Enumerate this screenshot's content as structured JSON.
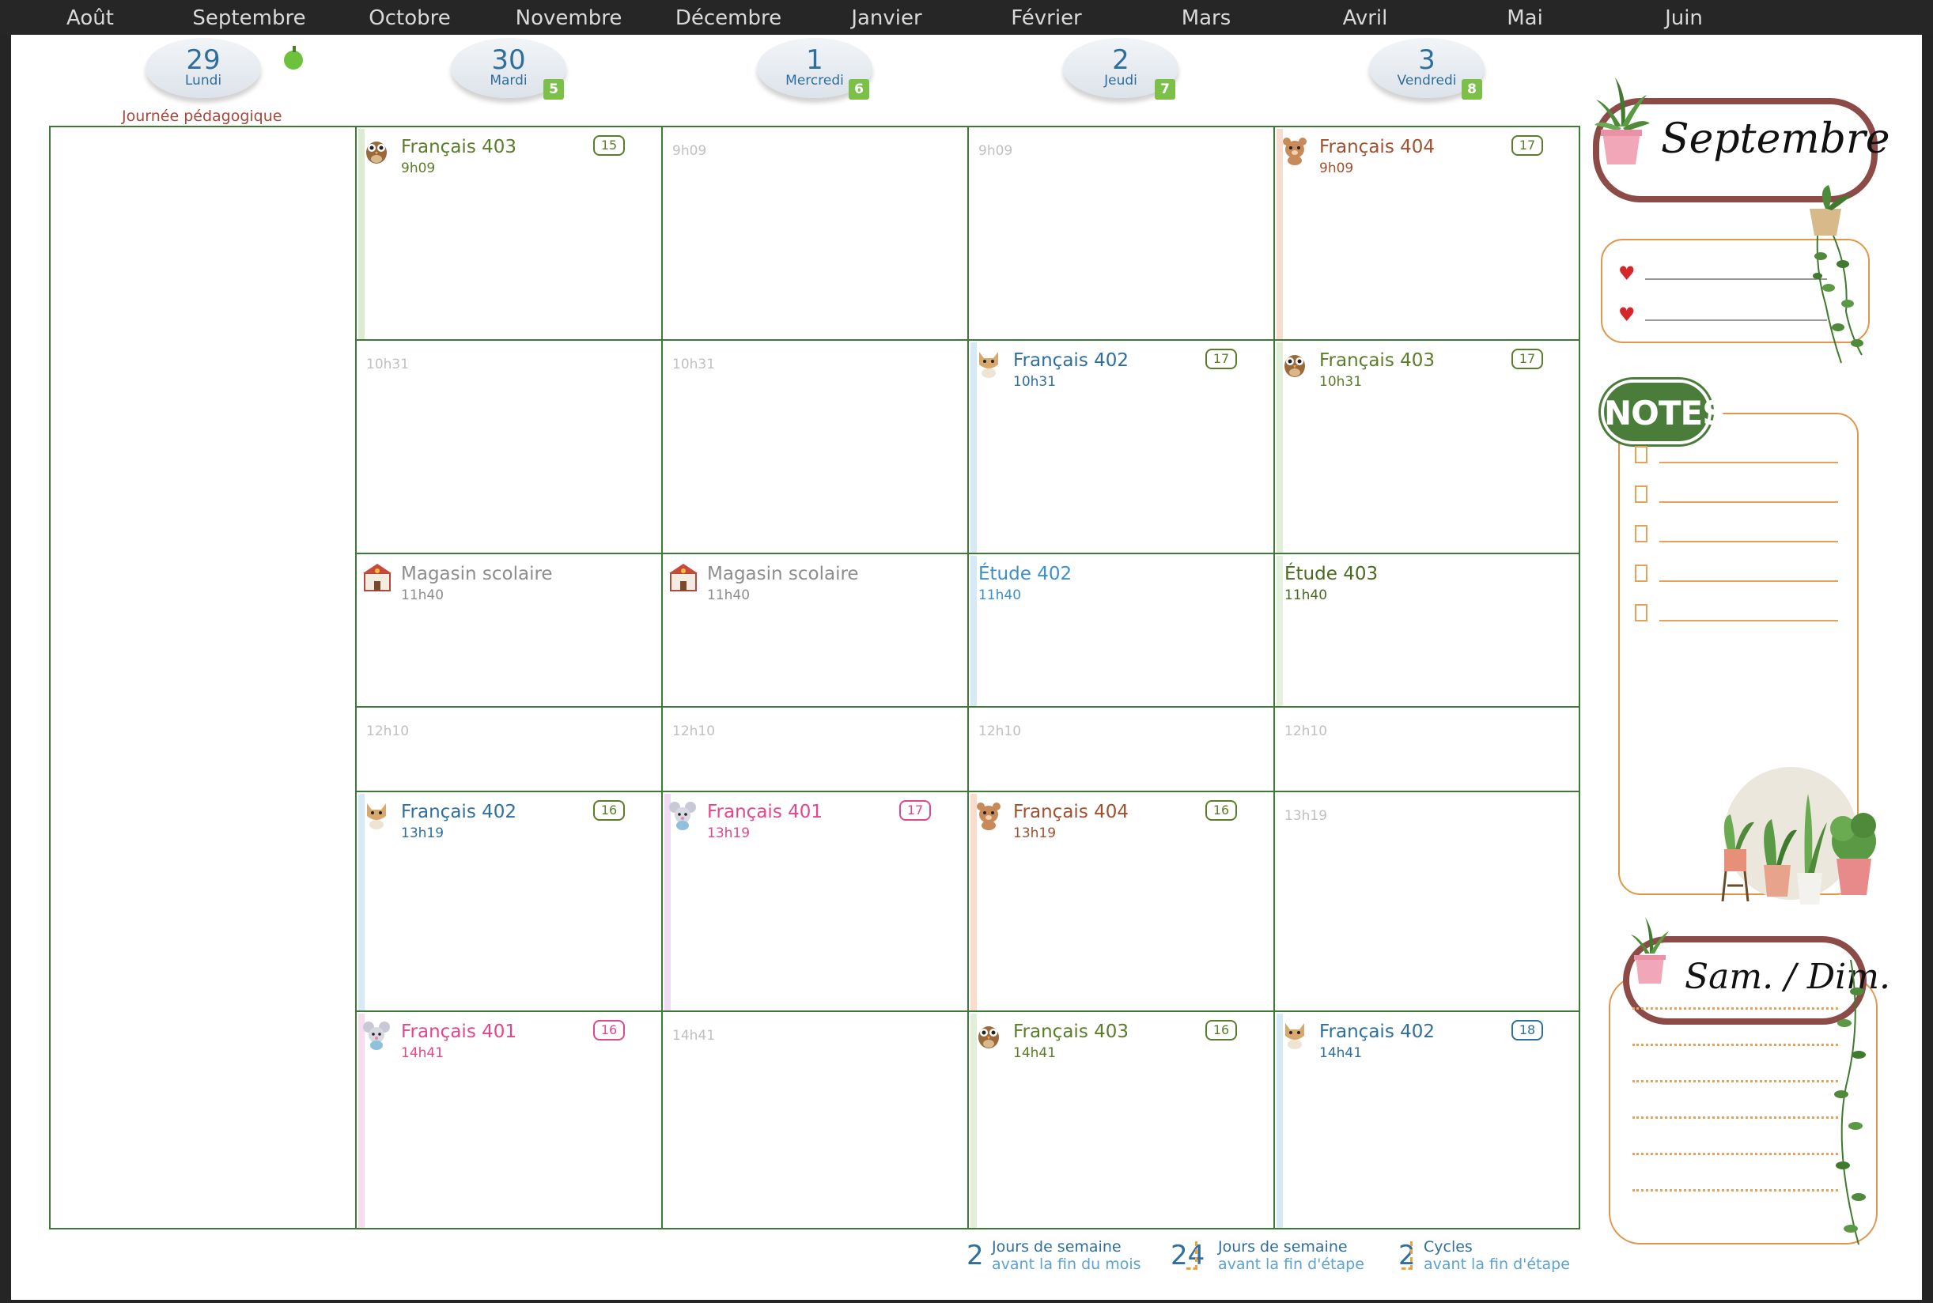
{
  "months": [
    "Août",
    "Septembre",
    "Octobre",
    "Novembre",
    "Décembre",
    "Janvier",
    "Février",
    "Mars",
    "Avril",
    "Mai",
    "Juin"
  ],
  "days": [
    {
      "num": "29",
      "name": "Lundi",
      "cycle": ""
    },
    {
      "num": "30",
      "name": "Mardi",
      "cycle": "5"
    },
    {
      "num": "1",
      "name": "Mercredi",
      "cycle": "6"
    },
    {
      "num": "2",
      "name": "Jeudi",
      "cycle": "7"
    },
    {
      "num": "3",
      "name": "Vendredi",
      "cycle": "8"
    }
  ],
  "event_note": "Journée pédagogique",
  "colors": {
    "fr401": "#e2468c",
    "fr402": "#2e6f9e",
    "fr403": "#5a7d2a",
    "fr404": "#a1502e",
    "store": "#8d8d8d",
    "etude402": "#3a8fd0",
    "etude403": "#4a6a1e",
    "grid": "#3d7a35"
  },
  "schedule": {
    "p1": {
      "mardi": {
        "title": "Français 403",
        "time": "9h09",
        "count": "15"
      },
      "mercredi": {
        "time": "9h09"
      },
      "jeudi": {
        "time": "9h09"
      },
      "vendredi": {
        "title": "Français 404",
        "time": "9h09",
        "count": "17"
      }
    },
    "p2": {
      "mardi": {
        "time": "10h31"
      },
      "mercredi": {
        "time": "10h31"
      },
      "jeudi": {
        "title": "Français 402",
        "time": "10h31",
        "count": "17"
      },
      "vendredi": {
        "title": "Français 403",
        "time": "10h31",
        "count": "17"
      }
    },
    "p3": {
      "mardi": {
        "title": "Magasin scolaire",
        "time": "11h40"
      },
      "mercredi": {
        "title": "Magasin scolaire",
        "time": "11h40"
      },
      "jeudi": {
        "title": "Étude 402",
        "time": "11h40"
      },
      "vendredi": {
        "title": "Étude 403",
        "time": "11h40"
      }
    },
    "p4": {
      "mardi": {
        "time": "12h10"
      },
      "mercredi": {
        "time": "12h10"
      },
      "jeudi": {
        "time": "12h10"
      },
      "vendredi": {
        "time": "12h10"
      }
    },
    "p5": {
      "mardi": {
        "title": "Français 402",
        "time": "13h19",
        "count": "16"
      },
      "mercredi": {
        "title": "Français 401",
        "time": "13h19",
        "count": "17"
      },
      "jeudi": {
        "title": "Français 404",
        "time": "13h19",
        "count": "16"
      },
      "vendredi": {
        "time": "13h19"
      }
    },
    "p6": {
      "mardi": {
        "title": "Français 401",
        "time": "14h41",
        "count": "16"
      },
      "mercredi": {
        "time": "14h41"
      },
      "jeudi": {
        "title": "Français 403",
        "time": "14h41",
        "count": "16"
      },
      "vendredi": {
        "title": "Français 402",
        "time": "14h41",
        "count": "18"
      }
    }
  },
  "counters": [
    {
      "num": "2",
      "line1": "Jours de semaine",
      "line2": "avant la fin du mois"
    },
    {
      "num": "24",
      "line1": "Jours de semaine",
      "line2": "avant la fin d'étape"
    },
    {
      "num": "2",
      "line1": "Cycles",
      "line2": "avant la fin d'étape"
    }
  ],
  "sidebar": {
    "month_title": "Septembre",
    "notes_label": "NOTES",
    "weekend_title": "Sam. / Dim."
  }
}
